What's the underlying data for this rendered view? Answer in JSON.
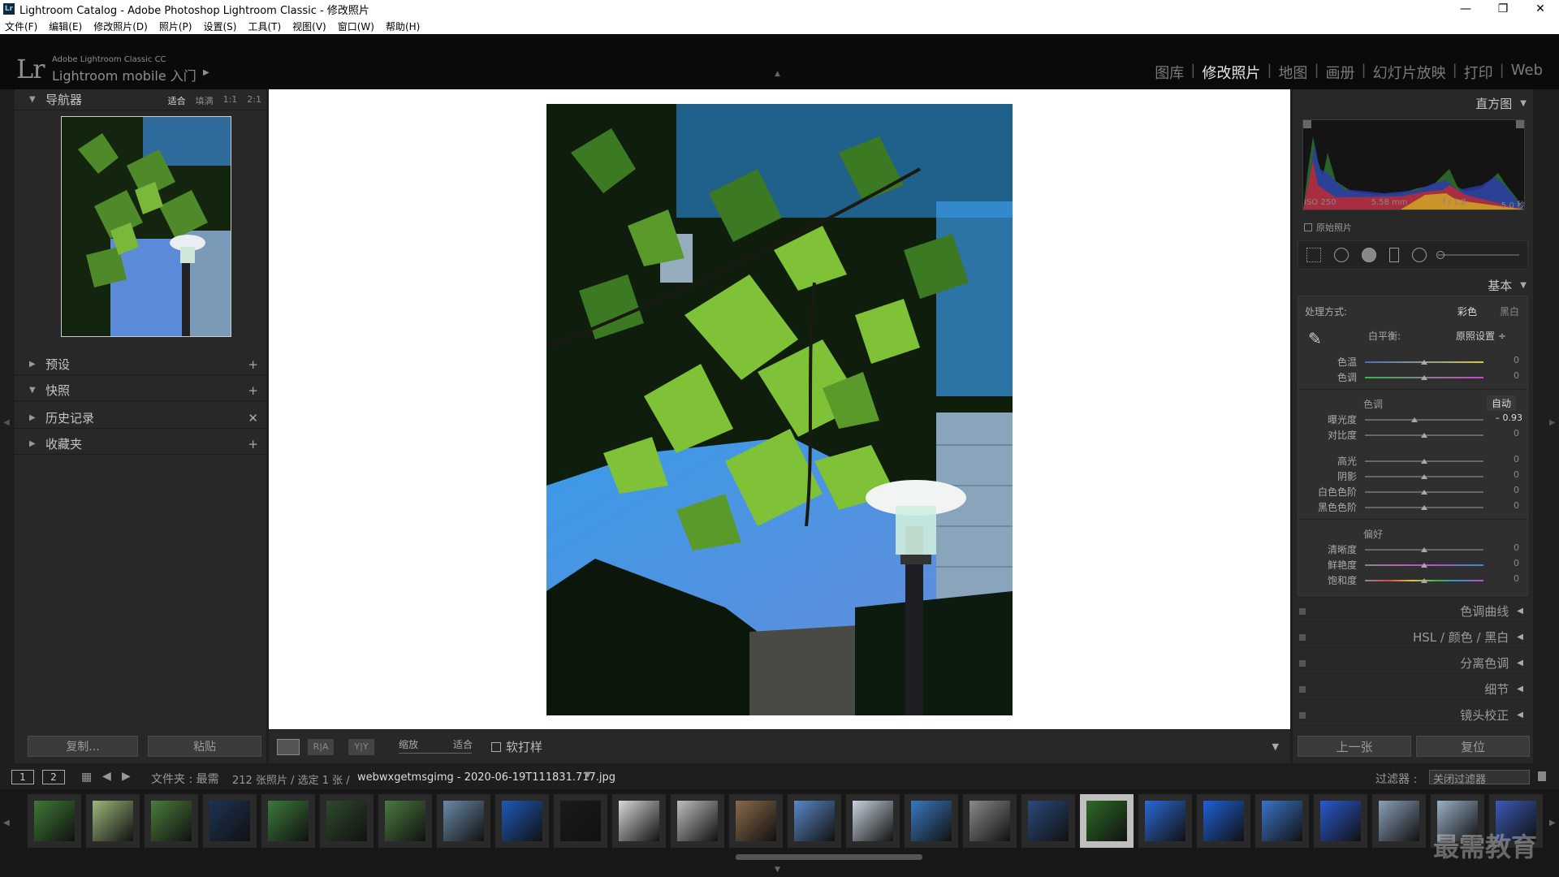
{
  "window": {
    "title": "Lightroom Catalog - Adobe Photoshop Lightroom Classic - 修改照片",
    "app_icon": "Lr",
    "controls": [
      "—",
      "❐",
      "✕"
    ]
  },
  "menu": [
    "文件(F)",
    "编辑(E)",
    "修改照片(D)",
    "照片(P)",
    "设置(S)",
    "工具(T)",
    "视图(V)",
    "窗口(W)",
    "帮助(H)"
  ],
  "brand": {
    "logo": "Lr",
    "line1": "Adobe Lightroom Classic CC",
    "line2": "Lightroom mobile 入门",
    "arrow": "▶"
  },
  "modules": {
    "items": [
      "图库",
      "修改照片",
      "地图",
      "画册",
      "幻灯片放映",
      "打印",
      "Web"
    ],
    "active": "修改照片",
    "separator": "|"
  },
  "left_panel": {
    "navigator": {
      "title": "导航器",
      "zoom": [
        "适合",
        "填满",
        "1:1",
        "2:1"
      ],
      "active_zoom": "适合"
    },
    "sections": [
      {
        "label": "预设",
        "icon": "+"
      },
      {
        "label": "快照",
        "icon": "+"
      },
      {
        "label": "历史记录",
        "icon": "✕"
      },
      {
        "label": "收藏夹",
        "icon": "+"
      }
    ],
    "copy_button": "复制...",
    "paste_button": "粘贴"
  },
  "toolbar": {
    "view_mode": "loupe",
    "ra_label": "R|A",
    "yy_label": "Y|Y",
    "zoom_label": "缩放",
    "fit_label": "适合",
    "soft_proof": "软打样",
    "caret": "▼"
  },
  "right_panel": {
    "histogram": {
      "title": "直方图",
      "iso": "ISO 250",
      "focal": "5.58 mm",
      "aperture": "f / 1.8",
      "shutter": "5.0 秒",
      "original_photo": "原始照片"
    },
    "basic": {
      "title": "基本",
      "treatment_label": "处理方式:",
      "color": "彩色",
      "bw": "黑白",
      "wb_label": "白平衡:",
      "wb_value": "原照设置 ÷",
      "temp": {
        "label": "色温",
        "value": "0",
        "pos": 0.5
      },
      "tint": {
        "label": "色调",
        "value": "0",
        "pos": 0.5
      },
      "tone_label": "色调",
      "auto": "自动",
      "exposure": {
        "label": "曝光度",
        "value": "– 0.93",
        "pos": 0.42
      },
      "contrast": {
        "label": "对比度",
        "value": "0",
        "pos": 0.5
      },
      "highlights": {
        "label": "高光",
        "value": "0",
        "pos": 0.5
      },
      "shadows": {
        "label": "阴影",
        "value": "0",
        "pos": 0.5
      },
      "whites": {
        "label": "白色色阶",
        "value": "0",
        "pos": 0.5
      },
      "blacks": {
        "label": "黑色色阶",
        "value": "0",
        "pos": 0.5
      },
      "presence_label": "偏好",
      "clarity": {
        "label": "清晰度",
        "value": "0",
        "pos": 0.5
      },
      "vibrance": {
        "label": "鲜艳度",
        "value": "0",
        "pos": 0.5
      },
      "saturation": {
        "label": "饱和度",
        "value": "0",
        "pos": 0.5
      }
    },
    "collapsed": [
      "色调曲线",
      "HSL  /  颜色  /  黑白",
      "分离色调",
      "细节",
      "镜头校正"
    ],
    "prev_button": "上一张",
    "reset_button": "复位"
  },
  "filmbar": {
    "page1": "1",
    "page2": "2",
    "folder": "文件夹 : 最需",
    "count": "212 张照片 / 选定 1 张 /",
    "filename": "webwxgetmsgimg - 2020-06-19T111831.717.jpg",
    "filter_label": "过滤器 :",
    "filter_value": "关闭过滤器"
  },
  "filmstrip": {
    "thumbs": [
      "#3f7a35",
      "#9ab87a",
      "#4a7c3a",
      "#1c3354",
      "#3d7a3a",
      "#2e4a2a",
      "#4c7a3e",
      "#6a8aa8",
      "#1e5ab8",
      "#1a1a1a",
      "#d8d8d8",
      "#bdbdbd",
      "#8a6a4a",
      "#5a88c8",
      "#c8d4e0",
      "#3a78c0",
      "#8a8a8a",
      "#2a4a7a",
      "#2e6a28",
      "#2a6ad8",
      "#1e60d8",
      "#3a74c8",
      "#2a5ad0",
      "#8aa0b8",
      "#9ab0c8",
      "#3a5ab8"
    ],
    "selected_index": 18
  },
  "watermark": "最需教育"
}
